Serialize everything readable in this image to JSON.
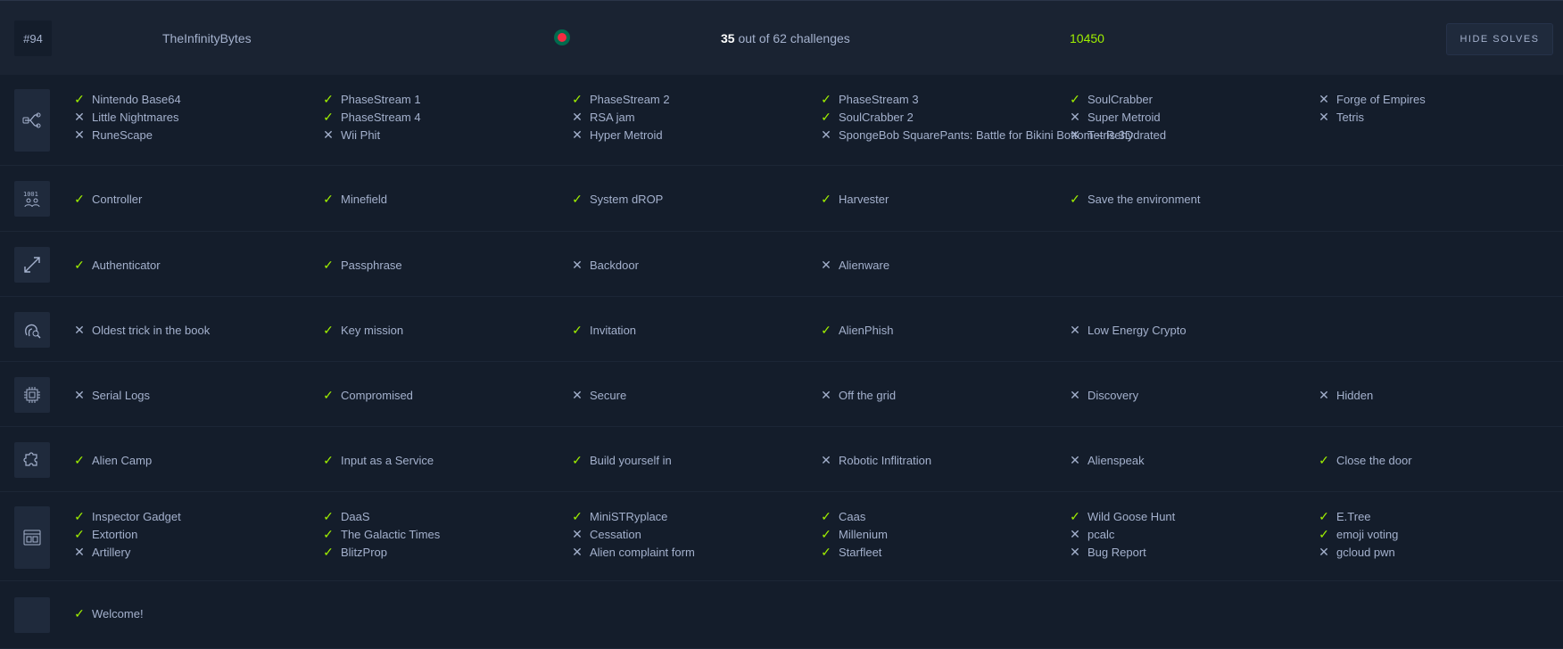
{
  "team": {
    "rank": "#94",
    "name": "TheInfinityBytes",
    "solved": "35",
    "progress_suffix": "out of 62 challenges",
    "points": "10450",
    "hide_label": "HIDE SOLVES"
  },
  "categories": [
    {
      "icon": "blockchain-icon",
      "challenges": [
        {
          "name": "Nintendo Base64",
          "solved": true
        },
        {
          "name": "PhaseStream 1",
          "solved": true
        },
        {
          "name": "PhaseStream 2",
          "solved": true
        },
        {
          "name": "PhaseStream 3",
          "solved": true
        },
        {
          "name": "SoulCrabber",
          "solved": true
        },
        {
          "name": "Forge of Empires",
          "solved": false
        },
        {
          "name": "Little Nightmares",
          "solved": false
        },
        {
          "name": "PhaseStream 4",
          "solved": true
        },
        {
          "name": "RSA jam",
          "solved": false
        },
        {
          "name": "SoulCrabber 2",
          "solved": true
        },
        {
          "name": "Super Metroid",
          "solved": false
        },
        {
          "name": "Tetris",
          "solved": false
        },
        {
          "name": "RuneScape",
          "solved": false
        },
        {
          "name": "Wii Phit",
          "solved": false
        },
        {
          "name": "Hyper Metroid",
          "solved": false
        },
        {
          "name": "SpongeBob SquarePants: Battle for Bikini Bottom – Rehydrated",
          "solved": false
        },
        {
          "name": "Tetris 3D",
          "solved": false
        }
      ]
    },
    {
      "icon": "binary-icon",
      "challenges": [
        {
          "name": "Controller",
          "solved": true
        },
        {
          "name": "Minefield",
          "solved": true
        },
        {
          "name": "System dROP",
          "solved": true
        },
        {
          "name": "Harvester",
          "solved": true
        },
        {
          "name": "Save the environment",
          "solved": true
        }
      ]
    },
    {
      "icon": "reversing-arrows-icon",
      "challenges": [
        {
          "name": "Authenticator",
          "solved": true
        },
        {
          "name": "Passphrase",
          "solved": true
        },
        {
          "name": "Backdoor",
          "solved": false
        },
        {
          "name": "Alienware",
          "solved": false
        }
      ]
    },
    {
      "icon": "forensics-fingerprint-icon",
      "challenges": [
        {
          "name": "Oldest trick in the book",
          "solved": false
        },
        {
          "name": "Key mission",
          "solved": true
        },
        {
          "name": "Invitation",
          "solved": true
        },
        {
          "name": "AlienPhish",
          "solved": true
        },
        {
          "name": "Low Energy Crypto",
          "solved": false
        }
      ]
    },
    {
      "icon": "hardware-chip-icon",
      "challenges": [
        {
          "name": "Serial Logs",
          "solved": false
        },
        {
          "name": "Compromised",
          "solved": true
        },
        {
          "name": "Secure",
          "solved": false
        },
        {
          "name": "Off the grid",
          "solved": false
        },
        {
          "name": "Discovery",
          "solved": false
        },
        {
          "name": "Hidden",
          "solved": false
        }
      ]
    },
    {
      "icon": "misc-puzzle-icon",
      "challenges": [
        {
          "name": "Alien Camp",
          "solved": true
        },
        {
          "name": "Input as a Service",
          "solved": true
        },
        {
          "name": "Build yourself in",
          "solved": true
        },
        {
          "name": "Robotic Inflitration",
          "solved": false
        },
        {
          "name": "Alienspeak",
          "solved": false
        },
        {
          "name": "Close the door",
          "solved": true
        }
      ]
    },
    {
      "icon": "web-browser-icon",
      "challenges": [
        {
          "name": "Inspector Gadget",
          "solved": true
        },
        {
          "name": "DaaS",
          "solved": true
        },
        {
          "name": "MiniSTRyplace",
          "solved": true
        },
        {
          "name": "Caas",
          "solved": true
        },
        {
          "name": "Wild Goose Hunt",
          "solved": true
        },
        {
          "name": "E.Tree",
          "solved": true
        },
        {
          "name": "Extortion",
          "solved": true
        },
        {
          "name": "The Galactic Times",
          "solved": true
        },
        {
          "name": "Cessation",
          "solved": false
        },
        {
          "name": "Millenium",
          "solved": true
        },
        {
          "name": "pcalc",
          "solved": false
        },
        {
          "name": "emoji voting",
          "solved": true
        },
        {
          "name": "Artillery",
          "solved": false
        },
        {
          "name": "BlitzProp",
          "solved": true
        },
        {
          "name": "Alien complaint form",
          "solved": false
        },
        {
          "name": "Starfleet",
          "solved": true
        },
        {
          "name": "Bug Report",
          "solved": false
        },
        {
          "name": "gcloud pwn",
          "solved": false
        }
      ]
    },
    {
      "icon": "blank-icon",
      "challenges": [
        {
          "name": "Welcome!",
          "solved": true
        }
      ]
    }
  ]
}
